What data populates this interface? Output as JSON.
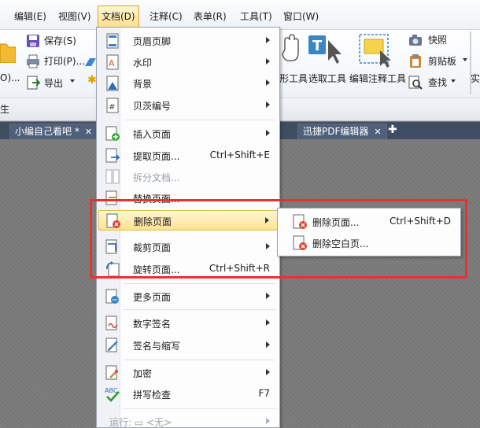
{
  "menubar": {
    "items": [
      "编辑(E)",
      "视图(V)",
      "文档(D)",
      "注释(C)",
      "表单(R)",
      "工具(T)",
      "窗口(W)"
    ],
    "active_index": 2
  },
  "ribbon": {
    "left_partial": "O)...",
    "save": "保存(S)",
    "print": "打印(P)...",
    "export": "导出",
    "tool_hand": "形工具",
    "tool_select": "选取工具",
    "tool_annotate": "编辑注释工具",
    "snapshot": "快照",
    "clipboard": "剪贴板",
    "find": "查找",
    "right_partial": "实",
    "bottom_left": "生"
  },
  "tabs": [
    {
      "label": "小编自己看吧 *"
    },
    {
      "label": "迅捷PDF编辑器"
    }
  ],
  "dropdown": {
    "items": [
      {
        "label": "页眉页脚",
        "shortcut": "",
        "submenu": true,
        "icon": "header-footer-icon"
      },
      {
        "label": "水印",
        "shortcut": "",
        "submenu": true,
        "icon": "watermark-icon"
      },
      {
        "label": "背景",
        "shortcut": "",
        "submenu": true,
        "icon": "background-icon"
      },
      {
        "label": "贝茨编号",
        "shortcut": "",
        "submenu": true,
        "icon": "bates-number-icon"
      },
      {
        "label": "插入页面",
        "shortcut": "",
        "submenu": true,
        "icon": "insert-page-icon"
      },
      {
        "label": "提取页面...",
        "shortcut": "Ctrl+Shift+E",
        "submenu": false,
        "icon": "extract-page-icon"
      },
      {
        "label": "拆分文档...",
        "shortcut": "",
        "submenu": false,
        "icon": "split-document-icon",
        "disabled": true
      },
      {
        "label": "替换页面...",
        "shortcut": "",
        "submenu": false,
        "icon": "replace-page-icon"
      },
      {
        "label": "删除页面",
        "shortcut": "",
        "submenu": true,
        "icon": "delete-page-icon",
        "highlighted": true
      },
      {
        "label": "裁剪页面",
        "shortcut": "",
        "submenu": true,
        "icon": "crop-page-icon"
      },
      {
        "label": "旋转页面...",
        "shortcut": "Ctrl+Shift+R",
        "submenu": false,
        "icon": "rotate-page-icon"
      },
      {
        "label": "更多页面",
        "shortcut": "",
        "submenu": true,
        "icon": "more-pages-icon"
      },
      {
        "label": "数字签名",
        "shortcut": "",
        "submenu": true,
        "icon": "digital-signature-icon"
      },
      {
        "label": "签名与缩写",
        "shortcut": "",
        "submenu": true,
        "icon": "sign-initials-icon"
      },
      {
        "label": "加密",
        "shortcut": "",
        "submenu": true,
        "icon": "encrypt-icon"
      },
      {
        "label": "拼写检查",
        "shortcut": "F7",
        "submenu": false,
        "icon": "spell-check-icon"
      },
      {
        "label": "运行: ▭ <无>",
        "shortcut": "",
        "submenu": true,
        "icon": "",
        "disabled": true
      }
    ]
  },
  "submenu": {
    "items": [
      {
        "label": "删除页面...",
        "shortcut": "Ctrl+Shift+D"
      },
      {
        "label": "删除空白页..."
      }
    ]
  },
  "colors": {
    "highlight": "#ffe38f",
    "annotation": "#e53333",
    "tabstrip": "#3f4d63"
  }
}
